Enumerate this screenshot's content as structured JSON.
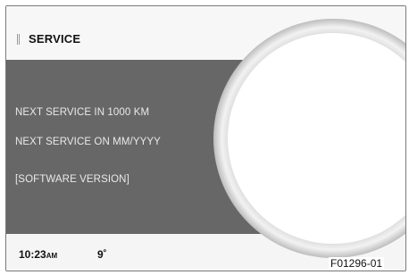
{
  "header": {
    "title": "SERVICE"
  },
  "info": {
    "next_service_distance": "NEXT SERVICE IN  1000 KM",
    "next_service_date": "NEXT SERVICE ON  MM/YYYY",
    "software_version": "[SOFTWARE VERSION]"
  },
  "status": {
    "time": "10:23",
    "ampm": "AM",
    "temperature": "9˚"
  },
  "figure_id": "F01296-01"
}
